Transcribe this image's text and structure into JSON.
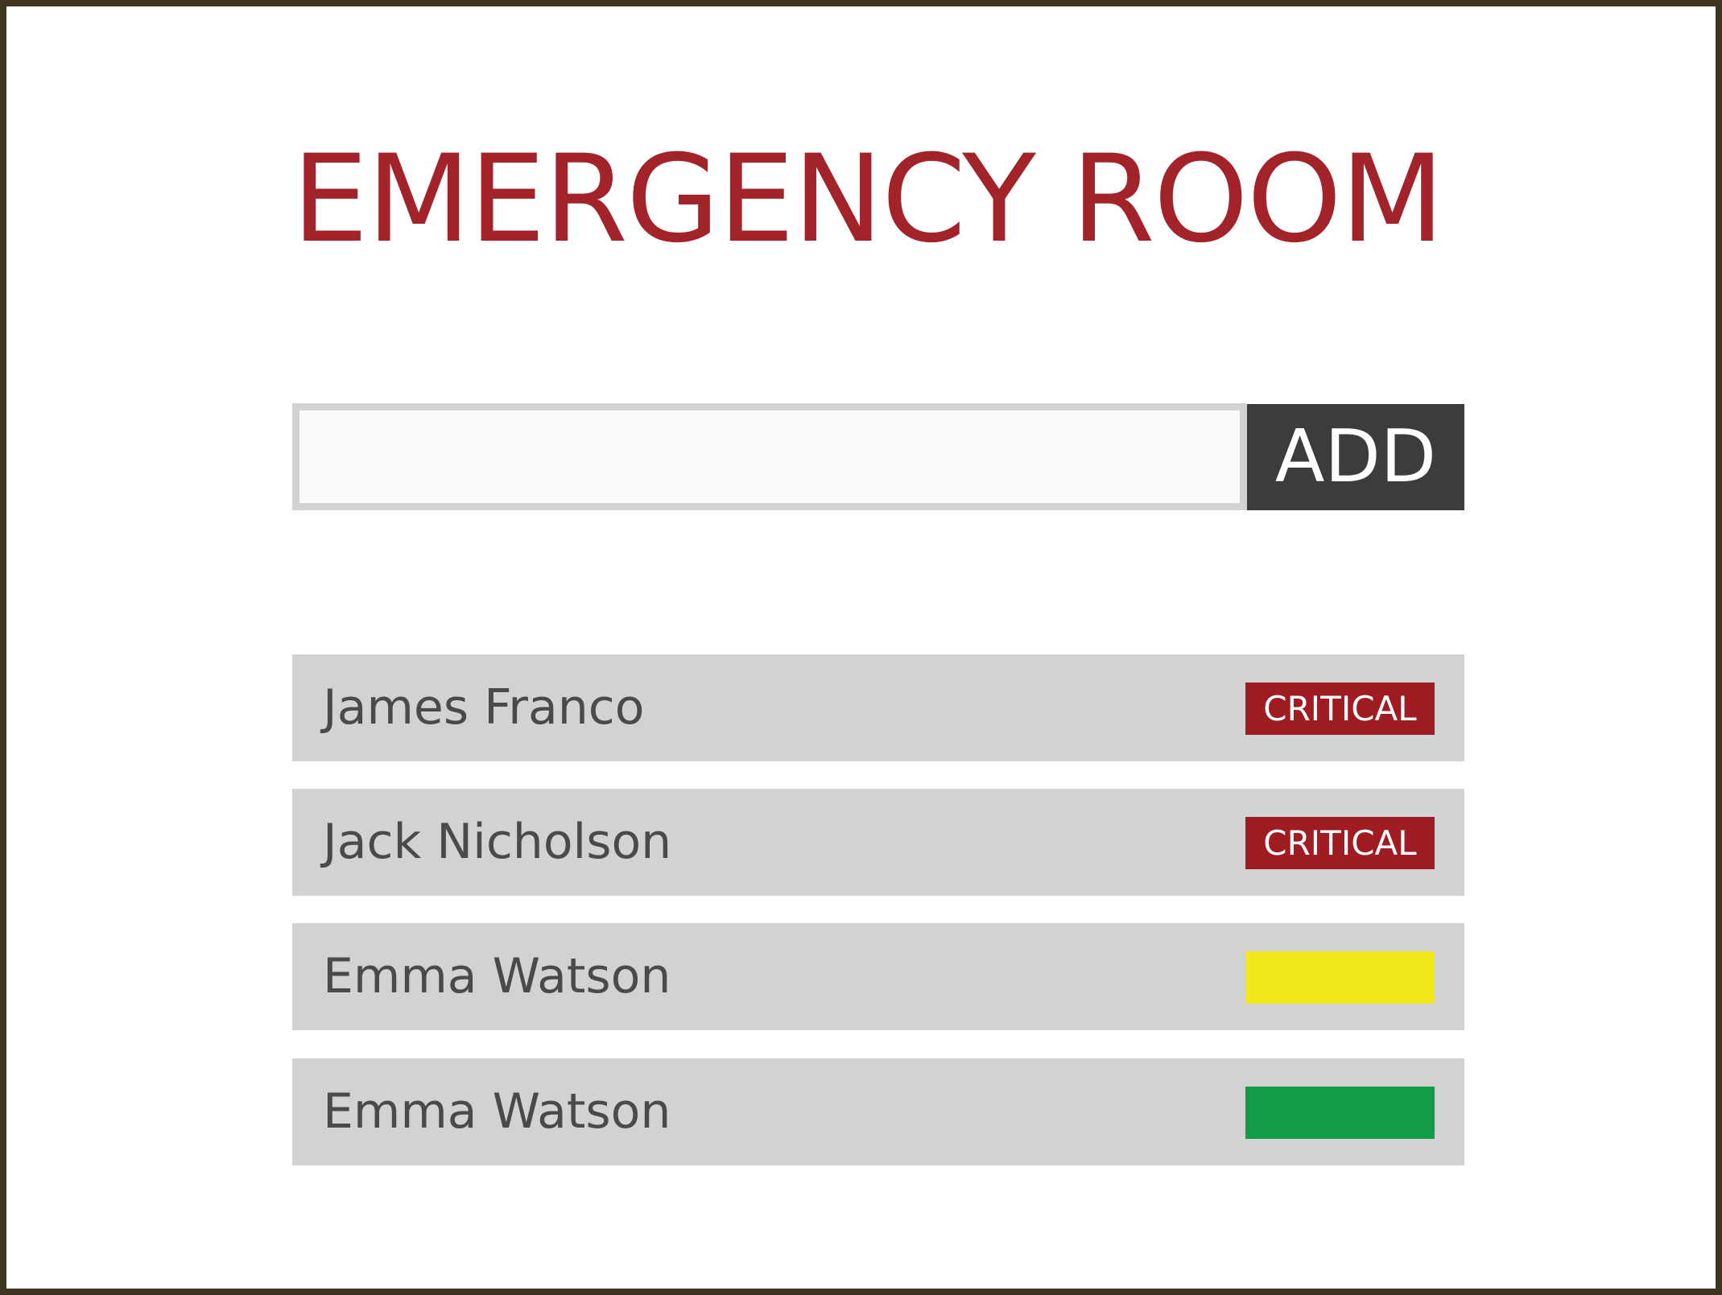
{
  "header": {
    "title": "EMERGENCY ROOM"
  },
  "add_form": {
    "input_value": "",
    "add_label": "ADD"
  },
  "patients": [
    {
      "name": "James Franco",
      "status_label": "CRITICAL",
      "status_color": "#9e1c22"
    },
    {
      "name": "Jack Nicholson",
      "status_label": "CRITICAL",
      "status_color": "#9e1c22"
    },
    {
      "name": "Emma Watson",
      "status_label": "",
      "status_color": "#f2e81a"
    },
    {
      "name": "Emma Watson",
      "status_label": "",
      "status_color": "#149b4a"
    }
  ],
  "colors": {
    "title": "#a3232a",
    "frame": "#3f3420",
    "row_background": "#d2d2d2",
    "button_background": "#3c3c3c"
  }
}
